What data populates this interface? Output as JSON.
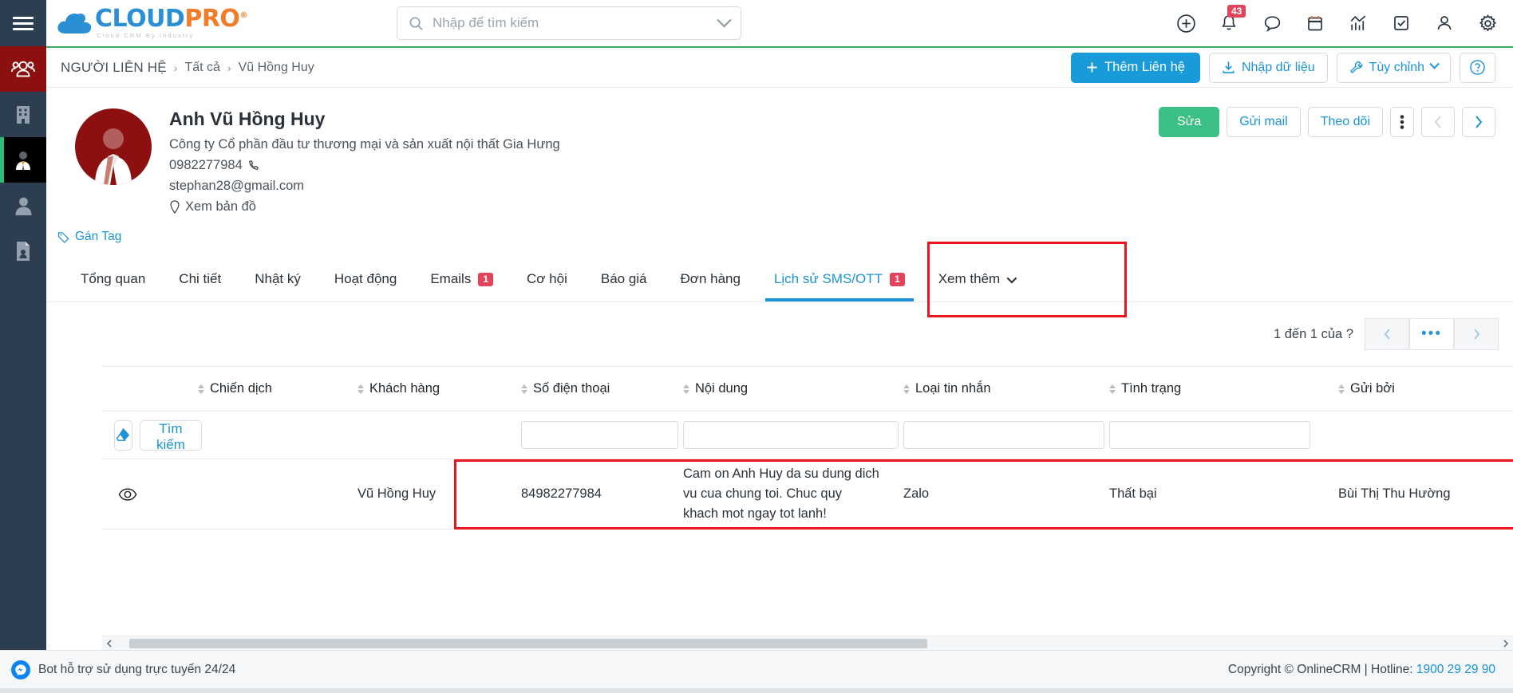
{
  "brand": {
    "name_part1": "CLOUD",
    "name_part2": "PRO",
    "registered": "®",
    "tagline": "Cloud CRM By Industry",
    "color_blue": "#2a8fd4",
    "color_orange": "#f07d2a"
  },
  "search": {
    "placeholder": "Nhập để tìm kiếm"
  },
  "topbar": {
    "icons": [
      {
        "name": "plus-circle-icon"
      },
      {
        "name": "bell-icon",
        "badge": "43"
      },
      {
        "name": "chat-bubble-icon"
      },
      {
        "name": "calendar-icon"
      },
      {
        "name": "analytics-chart-icon"
      },
      {
        "name": "task-check-icon"
      },
      {
        "name": "user-icon"
      },
      {
        "name": "gear-icon"
      }
    ],
    "notification_count": "43"
  },
  "rail": {
    "items": [
      {
        "name": "contacts-group-icon",
        "state": "highlight"
      },
      {
        "name": "company-building-icon",
        "state": "normal"
      },
      {
        "name": "contact-person-icon",
        "state": "active"
      },
      {
        "name": "user-profile-icon",
        "state": "normal"
      },
      {
        "name": "document-person-icon",
        "state": "normal"
      }
    ]
  },
  "breadcrumb": {
    "root": "NGƯỜI LIÊN HỆ",
    "separator": "›",
    "items": [
      "Tất cả",
      "Vũ Hồng Huy"
    ],
    "actions": {
      "add": "Thêm Liên hệ",
      "import": "Nhập dữ liệu",
      "customize": "Tùy chỉnh",
      "help": "?"
    }
  },
  "contact": {
    "name": "Anh Vũ Hồng Huy",
    "company": "Công ty Cổ phần đầu tư thương mại và sản xuất nội thất Gia Hưng",
    "phone": "0982277984",
    "email": "stephan28@gmail.com",
    "map_link": "Xem bản đồ",
    "tag_link": "Gán Tag",
    "actions": {
      "edit": "Sửa",
      "send_mail": "Gửi mail",
      "follow": "Theo dõi"
    }
  },
  "tabs": [
    {
      "label": "Tổng quan",
      "badge": null,
      "active": false
    },
    {
      "label": "Chi tiết",
      "badge": null,
      "active": false
    },
    {
      "label": "Nhật ký",
      "badge": null,
      "active": false
    },
    {
      "label": "Hoạt động",
      "badge": null,
      "active": false
    },
    {
      "label": "Emails",
      "badge": "1",
      "active": false
    },
    {
      "label": "Cơ hội",
      "badge": null,
      "active": false
    },
    {
      "label": "Báo giá",
      "badge": null,
      "active": false
    },
    {
      "label": "Đơn hàng",
      "badge": null,
      "active": false
    },
    {
      "label": "Lịch sử SMS/OTT",
      "badge": "1",
      "active": true
    },
    {
      "label": "Xem thêm",
      "badge": null,
      "active": false,
      "caret": true
    }
  ],
  "pagination": {
    "summary": "1 đến 1 của",
    "unknown_total": "?",
    "prev": "‹",
    "more": "•••",
    "next": "›"
  },
  "table": {
    "columns": [
      "Chiến dịch",
      "Khách hàng",
      "Số điện thoại",
      "Nội dung",
      "Loại tin nhắn",
      "Tình trạng",
      "Gửi bởi"
    ],
    "filter": {
      "clear_icon": "eraser-icon",
      "search_label": "Tìm kiếm"
    },
    "rows": [
      {
        "view_icon": "eye-icon",
        "campaign": "",
        "customer": "Vũ Hồng Huy",
        "phone": "84982277984",
        "content": "Cam on Anh Huy da su dung dich vu cua chung toi. Chuc quy khach mot ngay tot lanh!",
        "message_type": "Zalo",
        "status": "Thất bại",
        "sent_by": "Bùi Thị Thu Hường"
      }
    ]
  },
  "footer": {
    "bot_text": "Bot hỗ trợ sử dụng trực tuyến 24/24",
    "copyright": "Copyright © OnlineCRM | Hotline:",
    "hotline": "1900 29 29 90"
  },
  "annotations": {
    "tab_highlight_color": "#e8151c",
    "row_highlight_color": "#e8151c"
  }
}
